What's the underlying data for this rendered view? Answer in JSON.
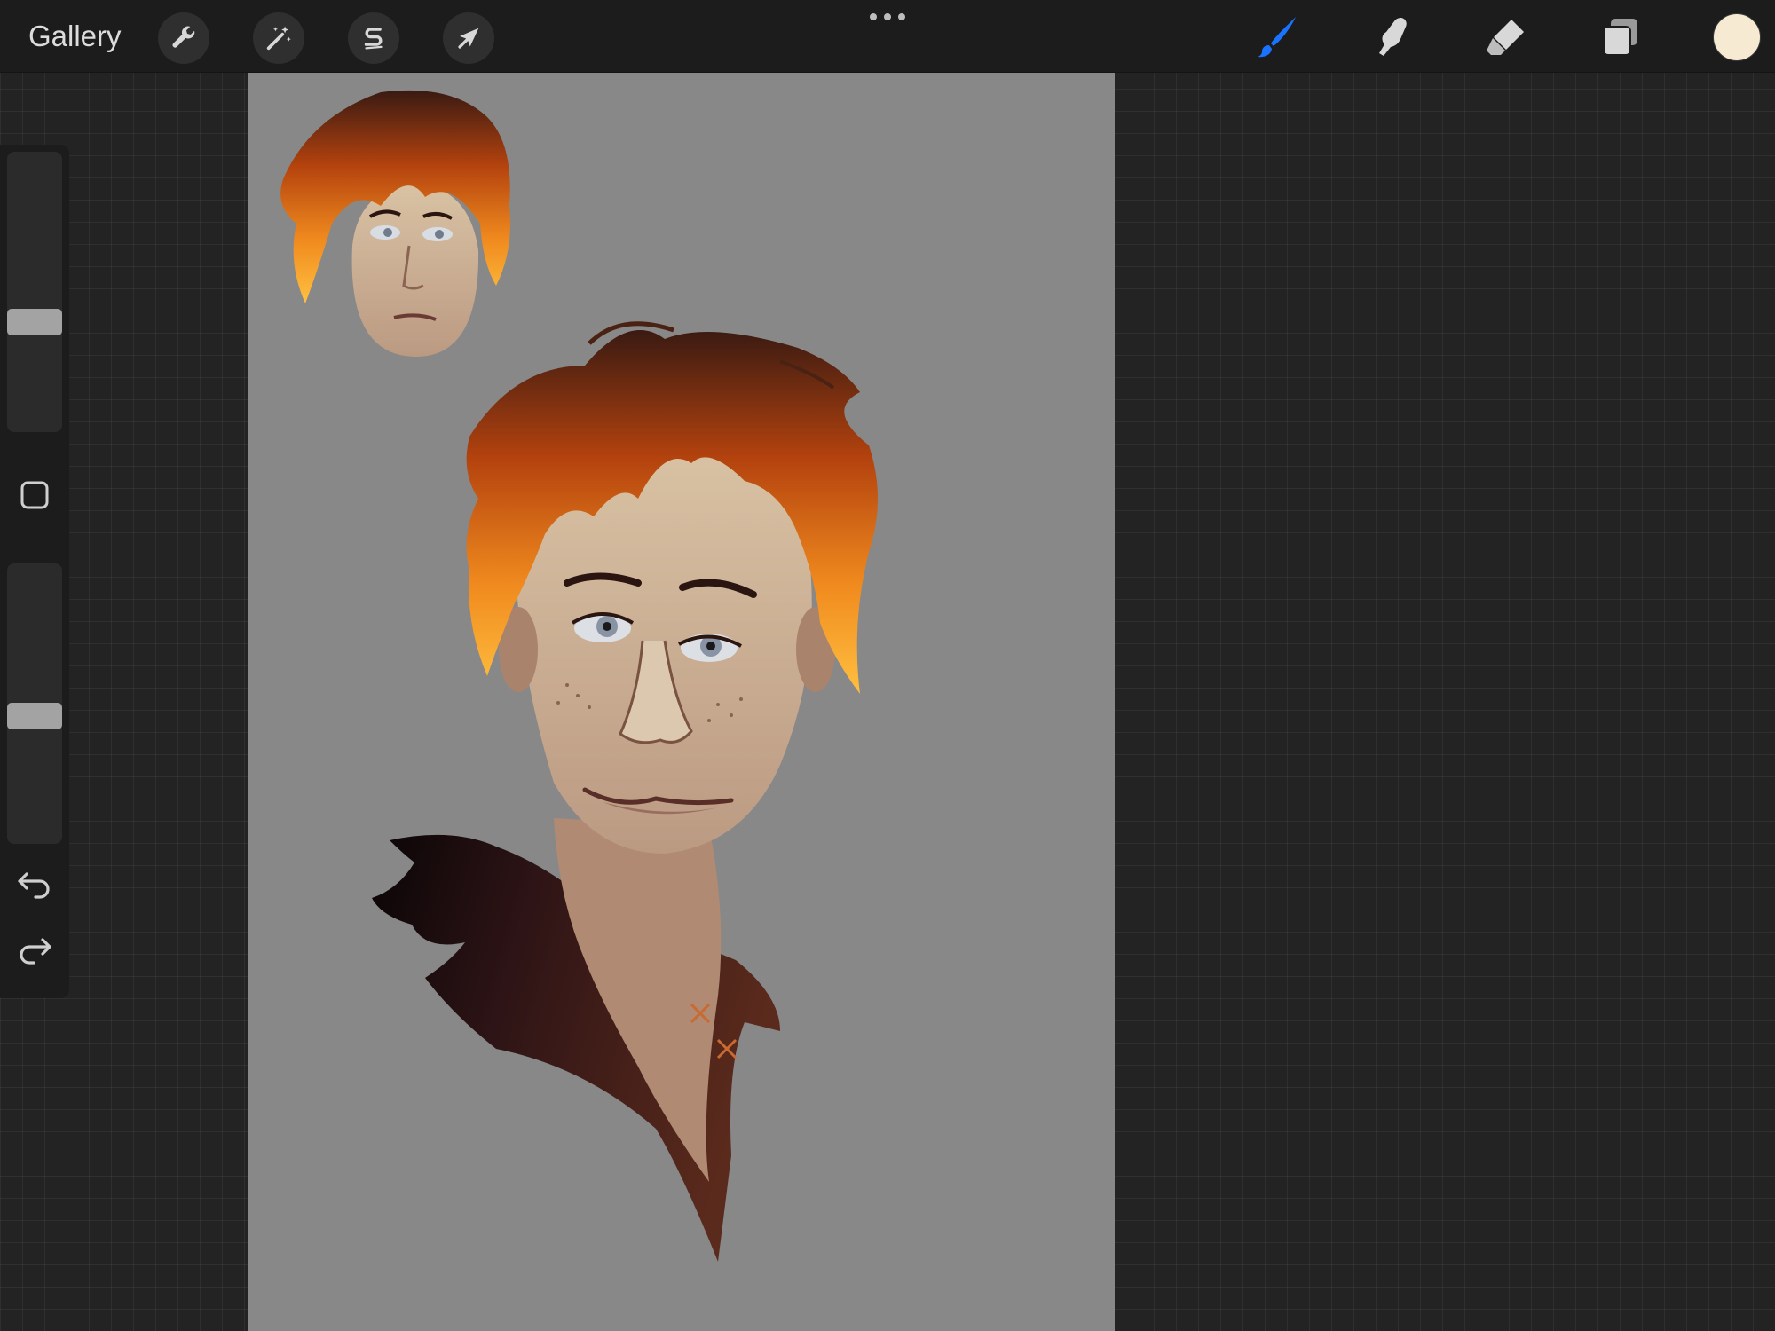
{
  "topbar": {
    "gallery_label": "Gallery",
    "left_tools": [
      {
        "name": "actions",
        "icon": "wrench-icon"
      },
      {
        "name": "adjustments",
        "icon": "magic-wand-icon"
      },
      {
        "name": "selection",
        "icon": "selection-s-icon"
      },
      {
        "name": "transform",
        "icon": "arrow-cursor-icon"
      }
    ],
    "more_icon": "ellipsis-icon",
    "right_tools": [
      {
        "name": "paint",
        "icon": "brush-icon",
        "active": true
      },
      {
        "name": "smudge",
        "icon": "smudge-finger-icon",
        "active": false
      },
      {
        "name": "erase",
        "icon": "eraser-icon",
        "active": false
      },
      {
        "name": "layers",
        "icon": "layers-icon",
        "active": false
      }
    ],
    "current_color": "#f7ead2",
    "active_color": "#1a73ff"
  },
  "sidebar": {
    "brush_size_level": 0.62,
    "brush_opacity_level": 0.55,
    "modify_icon": "square-icon",
    "undo_icon": "undo-icon",
    "redo_icon": "redo-icon"
  },
  "canvas": {
    "background_color": "#888888",
    "artwork": "painted-portrait"
  }
}
